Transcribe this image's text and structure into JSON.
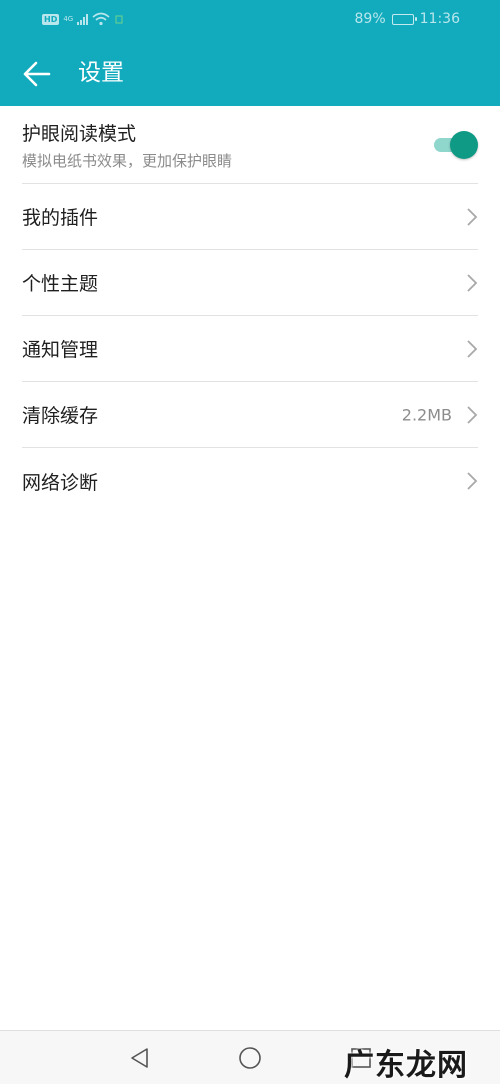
{
  "status_bar": {
    "hd_label": "HD",
    "network_label": "4G",
    "battery_percent": "89%",
    "battery_level": 0.89,
    "time": "11:36"
  },
  "app_bar": {
    "title": "设置",
    "back_icon": "arrow-left-icon"
  },
  "settings": {
    "eye_mode": {
      "label": "护眼阅读模式",
      "subtitle": "模拟电纸书效果，更加保护眼睛",
      "enabled": true
    },
    "items": [
      {
        "label": "我的插件",
        "value": ""
      },
      {
        "label": "个性主题",
        "value": ""
      },
      {
        "label": "通知管理",
        "value": ""
      },
      {
        "label": "清除缓存",
        "value": "2.2MB"
      },
      {
        "label": "网络诊断",
        "value": ""
      }
    ]
  },
  "nav_bar": {
    "back_icon": "triangle-back-icon",
    "home_icon": "circle-home-icon",
    "recent_icon": "square-recent-icon"
  },
  "watermark": "广东龙网",
  "colors": {
    "accent": "#12abbe",
    "toggle_on": "#0f9a86",
    "toggle_track": "#8fd6cc",
    "text_primary": "#1f1f1f",
    "text_secondary": "#8c8c8c"
  }
}
